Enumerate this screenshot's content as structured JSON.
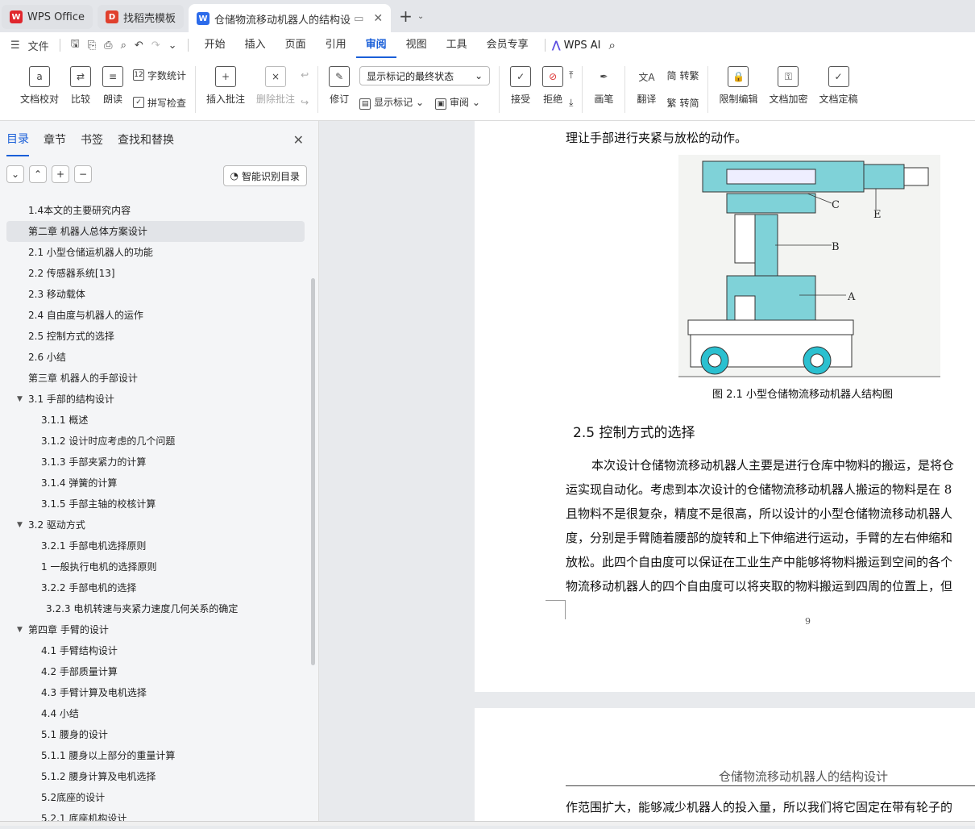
{
  "tabs": [
    {
      "label": "WPS Office",
      "icon": "wps-logo-icon"
    },
    {
      "label": "找稻壳模板",
      "icon": "daoke-logo-icon"
    },
    {
      "label": "仓储物流移动机器人的结构设",
      "icon": "wps-writer-icon"
    }
  ],
  "menu": {
    "file": "文件",
    "items": [
      "开始",
      "插入",
      "页面",
      "引用",
      "审阅",
      "视图",
      "工具",
      "会员专享"
    ],
    "active": "审阅",
    "ai": "WPS AI"
  },
  "ribbon": {
    "proofread": "文档校对",
    "compare": "比较",
    "read": "朗读",
    "word_count": "字数统计",
    "spell_check": "拼写检查",
    "insert_comment": "插入批注",
    "delete_comment": "删除批注",
    "revise": "修订",
    "markup_dropdown": "显示标记的最终状态",
    "show_markup": "显示标记",
    "review": "审阅",
    "accept": "接受",
    "reject": "拒绝",
    "pen": "画笔",
    "translate": "翻译",
    "to_trad": "转繁",
    "to_simp": "转简",
    "restrict": "限制编辑",
    "encrypt": "文档加密",
    "finalize": "文档定稿"
  },
  "nav": {
    "tabs": [
      "目录",
      "章节",
      "书签",
      "查找和替换"
    ],
    "smart_btn": "智能识别目录",
    "toc": [
      {
        "t": "1.4本文的主要研究内容",
        "lvl": 1
      },
      {
        "t": "第二章  机器人总体方案设计",
        "lvl": 1,
        "sel": true
      },
      {
        "t": "2.1  小型仓储运机器人的功能",
        "lvl": 1
      },
      {
        "t": "2.2  传感器系统[13]",
        "lvl": 1
      },
      {
        "t": "2.3  移动载体",
        "lvl": 1
      },
      {
        "t": "2.4  自由度与机器人的运作",
        "lvl": 1
      },
      {
        "t": "2.5  控制方式的选择",
        "lvl": 1
      },
      {
        "t": "2.6  小结",
        "lvl": 1
      },
      {
        "t": "第三章   机器人的手部设计",
        "lvl": 1
      },
      {
        "t": "3.1  手部的结构设计",
        "lvl": 1,
        "tri": true
      },
      {
        "t": "3.1.1  概述",
        "lvl": 2
      },
      {
        "t": "3.1.2  设计时应考虑的几个问题",
        "lvl": 2
      },
      {
        "t": "3.1.3  手部夹紧力的计算",
        "lvl": 2
      },
      {
        "t": "3.1.4  弹簧的计算",
        "lvl": 2
      },
      {
        "t": "3.1.5  手部主轴的校核计算",
        "lvl": 2
      },
      {
        "t": "3.2  驱动方式",
        "lvl": 1,
        "tri": true
      },
      {
        "t": "3.2.1  手部电机选择原则",
        "lvl": 2
      },
      {
        "t": "1  一般执行电机的选择原则",
        "lvl": 2
      },
      {
        "t": "3.2.2  手部电机的选择",
        "lvl": 2
      },
      {
        "t": "3.2.3  电机转速与夹紧力速度几何关系的确定",
        "lvl": 3
      },
      {
        "t": "第四章   手臂的设计",
        "lvl": 1,
        "tri": true
      },
      {
        "t": "4.1  手臂结构设计",
        "lvl": 2
      },
      {
        "t": "4.2  手部质量计算",
        "lvl": 2
      },
      {
        "t": "4.3  手臂计算及电机选择",
        "lvl": 2
      },
      {
        "t": "4.4    小结",
        "lvl": 2
      },
      {
        "t": "5.1  腰身的设计",
        "lvl": 2
      },
      {
        "t": "5.1.1  腰身以上部分的重量计算",
        "lvl": 2
      },
      {
        "t": "5.1.2  腰身计算及电机选择",
        "lvl": 2
      },
      {
        "t": "5.2底座的设计",
        "lvl": 2
      },
      {
        "t": "5.2.1  底座机构设计",
        "lvl": 2
      }
    ]
  },
  "doc": {
    "line_top": "理让手部进行夹紧与放松的动作。",
    "figure_labels": [
      "C",
      "E",
      "B",
      "A"
    ],
    "caption": "图 2.1  小型仓储物流移动机器人结构图",
    "heading": "2.5  控制方式的选择",
    "paras": [
      "本次设计仓储物流移动机器人主要是进行仓库中物料的搬运，是将仓",
      "运实现自动化。考虑到本次设计的仓储物流移动机器人搬运的物料是在 8",
      "且物料不是很复杂，精度不是很高，所以设计的小型仓储物流移动机器人",
      "度，分别是手臂随着腰部的旋转和上下伸缩进行运动，手臂的左右伸缩和",
      "放松。此四个自由度可以保证在工业生产中能够将物料搬运到空间的各个",
      "物流移动机器人的四个自由度可以将夹取的物料搬运到四周的位置上，但"
    ],
    "page_num": "9",
    "header2": "仓储物流移动机器人的结构设计",
    "line_p2": "作范围扩大，能够减少机器人的投入量，所以我们将它固定在带有轮子的"
  }
}
